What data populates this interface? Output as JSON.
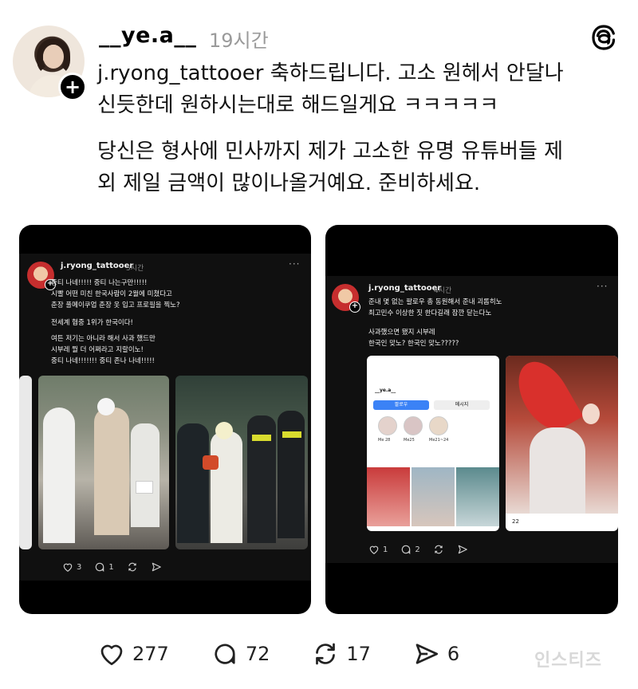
{
  "post": {
    "username": "__ye.a__",
    "time": "19시간",
    "text_1": "j.ryong_tattooer 축하드립니다. 고소 원헤서 안달나\n신듯한데 원하시는대로 해드일게요 ㅋㅋㅋㅋㅋ",
    "text_2": "당신은 형사에 민사까지 제가 고소한 유명 유튜버들 제\n외 제일 금액이 많이나올거예요. 준비하세요.",
    "likes": "277",
    "comments": "72",
    "reposts": "17",
    "shares": "6"
  },
  "quote_1": {
    "username": "j.ryong_tattooer",
    "time": "5시간",
    "text": "중티 나네!!!!! 중티 나는구만!!!!!\n시빨 어떤 미친 한국사람이 2월에 미쳤다고\n춘장 풀메이쿠업 춘장 옷 입고 프로필을 찍노?",
    "text_2": "전세계 혐중 1위가 한국이다!",
    "text_3": "여튼 저기는 아니라 해서 사과 했드만\n시부레 뭘 더 어쩌라고 지랄이노!\n중티 나네!!!!!!! 중티 존나 나네!!!!!",
    "likes": "3",
    "comments": "1"
  },
  "quote_2": {
    "username": "j.ryong_tattooer",
    "time": "4시간",
    "text": "준내 몇 없는 팔로우 총 동원해서 준내 괴롭히노\n최고민수 이상한 짓 한다길래 잠깐 닫는다노",
    "text_2": "사과했으면 됐지 시부레\n한국인 맞노? 한국인 맞노?????",
    "likes": "1",
    "comments": "2",
    "profile_follow": "팔로우",
    "profile_message": "메시지",
    "profile_name": "__ye.a__",
    "hl_1": "Me 28",
    "hl_2": "Me25",
    "hl_3": "Me21~24",
    "sub_comments": "22"
  },
  "watermark": "인스티즈"
}
